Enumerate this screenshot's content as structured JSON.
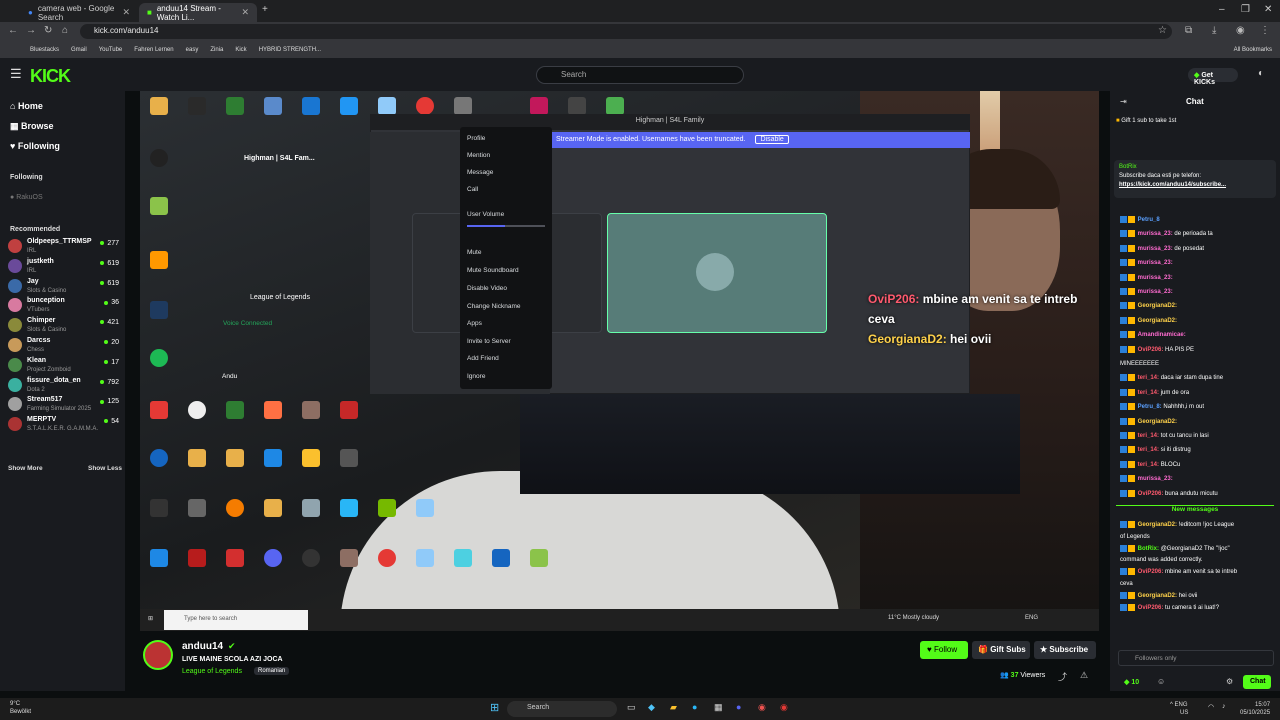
{
  "browser": {
    "tabs": [
      {
        "label": "camera web - Google Search",
        "active": false
      },
      {
        "label": "anduu14 Stream - Watch Li...",
        "active": true
      }
    ],
    "url": "kick.com/anduu14",
    "bookmarks": [
      "Bluestacks",
      "Gmail",
      "YouTube",
      "Fahren Lernen",
      "easy",
      "Zinia",
      "Kick",
      "HYBRID STRENGTH..."
    ],
    "all_bookmarks": "All Bookmarks"
  },
  "header": {
    "logo": "KICK",
    "search_placeholder": "Search",
    "get_kicks": "Get KICKs"
  },
  "sidebar": {
    "nav": [
      "Home",
      "Browse",
      "Following"
    ],
    "following_heading": "Following",
    "following_user": "RakuOS",
    "recommended_heading": "Recommended",
    "recommended": [
      {
        "name": "Oldpeeps_TTRMSP",
        "category": "IRL",
        "viewers": "277",
        "color": "#c04040"
      },
      {
        "name": "justketh",
        "category": "IRL",
        "viewers": "619",
        "color": "#6a4a9a"
      },
      {
        "name": "Jay",
        "category": "Slots & Casino",
        "viewers": "619",
        "color": "#3a6aa8"
      },
      {
        "name": "bunception",
        "category": "VTubers",
        "viewers": "36",
        "color": "#d87aa0"
      },
      {
        "name": "Chimper",
        "category": "Slots & Casino",
        "viewers": "421",
        "color": "#8a8a3a"
      },
      {
        "name": "Darcss",
        "category": "Chess",
        "viewers": "20",
        "color": "#c89a5a"
      },
      {
        "name": "Klean",
        "category": "Project Zomboid",
        "viewers": "17",
        "color": "#4a8a4a"
      },
      {
        "name": "fissure_dota_en",
        "category": "Dota 2",
        "viewers": "792",
        "color": "#3ab0a0"
      },
      {
        "name": "Stream517",
        "category": "Farming Simulator 2025",
        "viewers": "125",
        "color": "#a0a0a0"
      },
      {
        "name": "MERPTV",
        "category": "S.T.A.L.K.E.R. G.A.M.M.A.",
        "viewers": "54",
        "color": "#aa3333"
      }
    ],
    "show_more": "Show More",
    "show_less": "Show Less"
  },
  "video": {
    "discord_title": "Highman | S4L Family",
    "streamer_mode": "Streamer Mode is enabled. Usernames have been truncated.",
    "disable": "Disable",
    "server_name": "Highman | S4L Fam...",
    "game": "League of Legends",
    "voice_connected": "Voice Connected",
    "user_in_voice": "Andu",
    "context_menu": [
      "Profile",
      "Mention",
      "Message",
      "Call",
      "User Volume",
      "Mute",
      "Mute Soundboard",
      "Disable Video",
      "Change Nickname",
      "Apps",
      "Invite to Server",
      "Add Friend",
      "Ignore"
    ],
    "overlay_chat": [
      {
        "user": "OviP206:",
        "text": "mbine am venit sa te intreb ceva"
      },
      {
        "user": "GeorgianaD2:",
        "text": "hei ovii"
      }
    ],
    "taskbar_search": "Type here to search",
    "taskbar_weather": "11°C  Mostly cloudy",
    "taskbar_lang": "ENG"
  },
  "channel": {
    "name": "anduu14",
    "title": "LIVE MAINE SCOLA AZI JOCA",
    "category": "League of Legends",
    "language": "Romanian",
    "follow": "Follow",
    "gift_subs": "Gift Subs",
    "subscribe": "Subscribe",
    "viewers": "37",
    "viewers_label": "Viewers"
  },
  "chat": {
    "title": "Chat",
    "gift_pin": "Gift 1 sub to take 1st",
    "pinned_sender": "BotRix",
    "pinned_text": "Subscribe daca esti pe telefon:",
    "pinned_link": "https://kick.com/anduu14/subscribe...",
    "messages": [
      {
        "user": "Petru_8",
        "text": "",
        "color": "#5aa0ff"
      },
      {
        "user": "murissa_23:",
        "text": "de perioada ta",
        "color": "#ff6bd0"
      },
      {
        "user": "murissa_23:",
        "text": "de posedat",
        "color": "#ff6bd0"
      },
      {
        "user": "murissa_23:",
        "text": "",
        "color": "#ff6bd0"
      },
      {
        "user": "murissa_23:",
        "text": "",
        "color": "#ff6bd0"
      },
      {
        "user": "murissa_23:",
        "text": "",
        "color": "#ff6bd0"
      },
      {
        "user": "GeorgianaD2:",
        "text": "",
        "color": "#ffd24a"
      },
      {
        "user": "GeorgianaD2:",
        "text": "",
        "color": "#ffd24a"
      },
      {
        "user": "Amandinamicae:",
        "text": "",
        "color": "#ff6bd0"
      },
      {
        "user": "OviP206:",
        "text": "HA PIS PE",
        "color": "#ff5a6e"
      },
      {
        "user": "",
        "text": "MINEEEEEEE",
        "color": "#ffffff"
      },
      {
        "user": "teri_14:",
        "text": "daca iar stam dupa tine",
        "color": "#ff5a6e"
      },
      {
        "user": "teri_14:",
        "text": "jum de ora",
        "color": "#ff5a6e"
      },
      {
        "user": "Petru_8:",
        "text": "Nahhhh,i m out",
        "color": "#5aa0ff"
      },
      {
        "user": "GeorgianaD2:",
        "text": "",
        "color": "#ffd24a"
      },
      {
        "user": "teri_14:",
        "text": "tot cu tancu in lasi",
        "color": "#ff5a6e"
      },
      {
        "user": "teri_14:",
        "text": "si iti distrug",
        "color": "#ff5a6e"
      },
      {
        "user": "teri_14:",
        "text": "BLOCu",
        "color": "#ff5a6e"
      },
      {
        "user": "murissa_23:",
        "text": "",
        "color": "#ff6bd0"
      },
      {
        "user": "OviP206:",
        "text": "buna andutu micutu",
        "color": "#ff5a6e"
      }
    ],
    "new_messages": "New messages",
    "new_msgs": [
      {
        "user": "GeorgianaD2:",
        "text": "!editcom !joc League",
        "color": "#ffd24a"
      },
      {
        "user": "",
        "text": "of Legends",
        "color": "#ffffff"
      },
      {
        "user": "BotRix:",
        "text": "@GeorgianaD2 The \"!joc\"",
        "color": "#53fc18"
      },
      {
        "user": "",
        "text": "command was added correctly.",
        "color": "#ffffff"
      },
      {
        "user": "OviP206:",
        "text": "mbine am venit sa te intreb",
        "color": "#ff5a6e"
      },
      {
        "user": "",
        "text": "ceva",
        "color": "#ffffff"
      },
      {
        "user": "GeorgianaD2:",
        "text": "hei ovii",
        "color": "#ffd24a"
      },
      {
        "user": "OviP206:",
        "text": "tu camera ti ai luat!?",
        "color": "#ff5a6e"
      }
    ],
    "input_placeholder": "Followers only",
    "kick_count": "10",
    "send": "Chat"
  },
  "os": {
    "weather_temp": "9°C",
    "weather_text": "Bewölkt",
    "search": "Search",
    "lang": "ENG",
    "region": "US",
    "time": "15:07",
    "date": "05/10/2025"
  }
}
